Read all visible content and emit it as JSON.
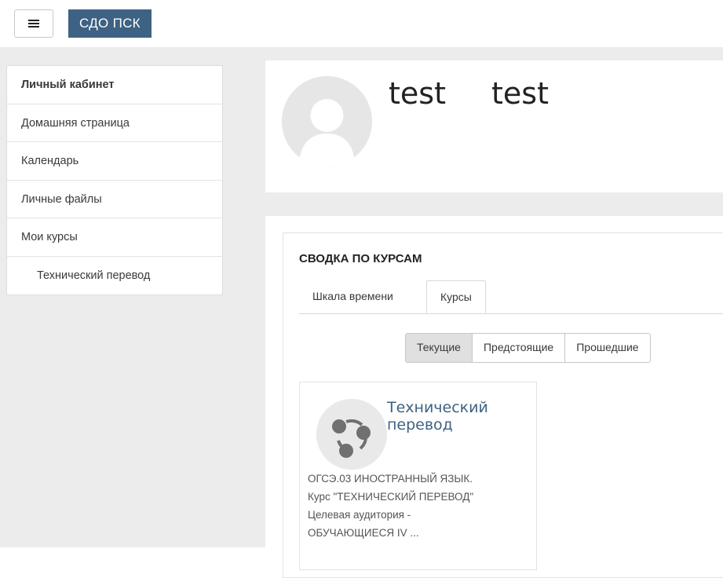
{
  "navbar": {
    "brand": "СДО ПСК"
  },
  "sidebar": {
    "items": [
      {
        "label": "Личный кабинет"
      },
      {
        "label": "Домашняя страница"
      },
      {
        "label": "Календарь"
      },
      {
        "label": "Личные файлы"
      },
      {
        "label": "Мои курсы"
      },
      {
        "label": "Технический перевод"
      }
    ]
  },
  "profile": {
    "first_name": "test",
    "last_name": "test"
  },
  "overview": {
    "title": "СВОДКА ПО КУРСАМ",
    "tabs": [
      {
        "label": "Шкала времени"
      },
      {
        "label": "Курсы"
      }
    ],
    "filters": [
      {
        "label": "Текущие"
      },
      {
        "label": "Предстоящие"
      },
      {
        "label": "Прошедшие"
      }
    ],
    "course": {
      "title": "Технический перевод",
      "description": "ОГСЭ.03 ИНОСТРАННЫЙ ЯЗЫК.\nКурс \"ТЕХНИЧЕСКИЙ ПЕРЕВОД\"\nЦелевая аудитория -\nОБУЧАЮЩИЕСЯ IV ..."
    }
  },
  "colors": {
    "brand": "#3e6283",
    "page_bg": "#ececec",
    "link": "#3e6283"
  },
  "icons": {
    "menu": "hamburger-icon",
    "avatar": "user-avatar-icon",
    "course": "course-share-icon"
  }
}
